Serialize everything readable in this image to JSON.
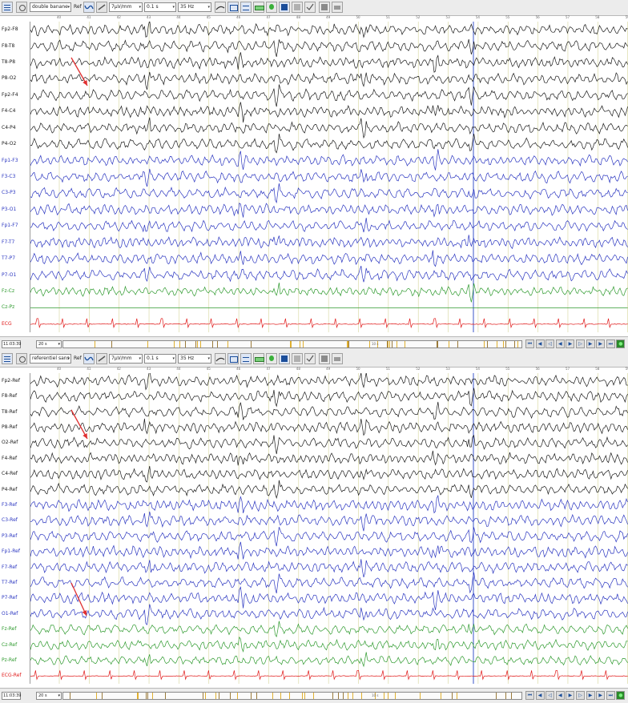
{
  "colors": {
    "black": "#1a1a1a",
    "blue": "#2a35c0",
    "green": "#2e9a2e",
    "red": "#e01818",
    "arrow": "#e03030",
    "cursor": "#3a55c8",
    "grid": "#d6d69a"
  },
  "panels": [
    {
      "montage": "double banane",
      "ref_label": "Ref",
      "gain": "7µV/mm",
      "timebase": "0.1 s",
      "filter": "35 Hz",
      "time_display": "11:03:39",
      "duration": "20 s",
      "seconds_tick": "10 s",
      "channels": [
        {
          "label": "Fp2-F8",
          "color": "black"
        },
        {
          "label": "F8-T8",
          "color": "black"
        },
        {
          "label": "T8-P8",
          "color": "black"
        },
        {
          "label": "P8-O2",
          "color": "black"
        },
        {
          "label": "Fp2-F4",
          "color": "black"
        },
        {
          "label": "F4-C4",
          "color": "black"
        },
        {
          "label": "C4-P4",
          "color": "black"
        },
        {
          "label": "P4-O2",
          "color": "black"
        },
        {
          "label": "Fp1-F3",
          "color": "blue"
        },
        {
          "label": "F3-C3",
          "color": "blue"
        },
        {
          "label": "C3-P3",
          "color": "blue"
        },
        {
          "label": "P3-O1",
          "color": "blue"
        },
        {
          "label": "Fp1-F7",
          "color": "blue"
        },
        {
          "label": "F7-T7",
          "color": "blue"
        },
        {
          "label": "T7-P7",
          "color": "blue"
        },
        {
          "label": "P7-O1",
          "color": "blue"
        },
        {
          "label": "Fz-Cz",
          "color": "green"
        },
        {
          "label": "Cz-Pz",
          "color": "green"
        },
        {
          "label": "ECG",
          "color": "red"
        }
      ]
    },
    {
      "montage": "referentiel sans t",
      "ref_label": "Ref",
      "gain": "7µV/mm",
      "timebase": "0.1 s",
      "filter": "35 Hz",
      "time_display": "11:03:39",
      "duration": "20 s",
      "seconds_tick": "10 s",
      "channels": [
        {
          "label": "Fp2-Ref",
          "color": "black"
        },
        {
          "label": "F8-Ref",
          "color": "black"
        },
        {
          "label": "T8-Ref",
          "color": "black"
        },
        {
          "label": "P8-Ref",
          "color": "black"
        },
        {
          "label": "O2-Ref",
          "color": "black"
        },
        {
          "label": "F4-Ref",
          "color": "black"
        },
        {
          "label": "C4-Ref",
          "color": "black"
        },
        {
          "label": "P4-Ref",
          "color": "black"
        },
        {
          "label": "F3-Ref",
          "color": "blue"
        },
        {
          "label": "C3-Ref",
          "color": "blue"
        },
        {
          "label": "P3-Ref",
          "color": "blue"
        },
        {
          "label": "Fp1-Ref",
          "color": "blue"
        },
        {
          "label": "F7-Ref",
          "color": "blue"
        },
        {
          "label": "T7-Ref",
          "color": "blue"
        },
        {
          "label": "P7-Ref",
          "color": "blue"
        },
        {
          "label": "O1-Ref",
          "color": "blue"
        },
        {
          "label": "Fz-Ref",
          "color": "green"
        },
        {
          "label": "Cz-Ref",
          "color": "green"
        },
        {
          "label": "Pz-Ref",
          "color": "green"
        },
        {
          "label": "ECG-Ref",
          "color": "red"
        }
      ]
    }
  ],
  "time_ticks": [
    "40",
    "41",
    "42",
    "43",
    "44",
    "45",
    "46",
    "47",
    "48",
    "49",
    "50",
    "51",
    "52",
    "53",
    "54",
    "55",
    "56",
    "57",
    "58",
    "59"
  ],
  "icons": {
    "menu": "hamburger-menu-icon",
    "settings": "brain-settings-icon",
    "filter": "waveform-filter-icon",
    "link": "link-icon",
    "pen": "signature-pen-icon",
    "layout1": "layout-grid-icon",
    "layout2": "layout-strip-icon",
    "battery": "battery-icon",
    "lamp": "indicator-lamp-icon",
    "video": "video-camera-icon",
    "box": "package-icon",
    "check": "checklist-icon",
    "save": "save-disk-icon",
    "print": "printer-icon"
  }
}
